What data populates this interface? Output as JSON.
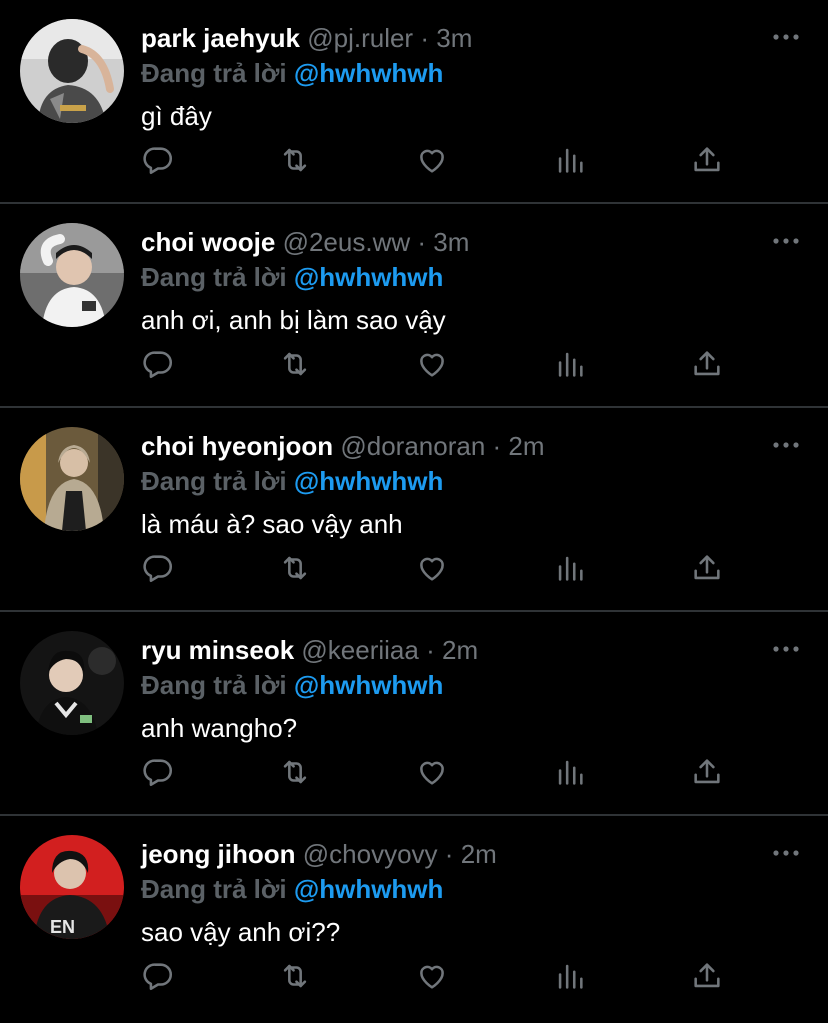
{
  "reply_prefix": "Đang trả lời",
  "icons": {
    "more": "more-dots-icon",
    "reply": "reply-icon",
    "retweet": "retweet-icon",
    "like": "heart-icon",
    "stats": "analytics-icon",
    "share": "share-icon"
  },
  "colors": {
    "background": "#000000",
    "name": "#ffffff",
    "meta": "#71767b",
    "mention": "#1d9bf0",
    "reply_prefix": "#5b6166",
    "divider": "#2f3336"
  },
  "tweets": [
    {
      "name": "park jaehyuk",
      "handle": "@pj.ruler",
      "separator": "·",
      "time": "3m",
      "mention": "@hwhwhwh",
      "text": "gì đây"
    },
    {
      "name": "choi wooje",
      "handle": "@2eus.ww",
      "separator": "·",
      "time": "3m",
      "mention": "@hwhwhwh",
      "text": "anh ơi, anh bị làm sao vậy"
    },
    {
      "name": "choi hyeonjoon",
      "handle": "@doranoran",
      "separator": "·",
      "time": "2m",
      "mention": "@hwhwhwh",
      "text": "là máu à? sao vậy anh"
    },
    {
      "name": "ryu minseok",
      "handle": "@keeriiaa",
      "separator": "·",
      "time": "2m",
      "mention": "@hwhwhwh",
      "text": "anh wangho?"
    },
    {
      "name": "jeong jihoon",
      "handle": "@chovyovy",
      "separator": "·",
      "time": "2m",
      "mention": "@hwhwhwh",
      "text": "sao vậy anh ơi??"
    }
  ]
}
